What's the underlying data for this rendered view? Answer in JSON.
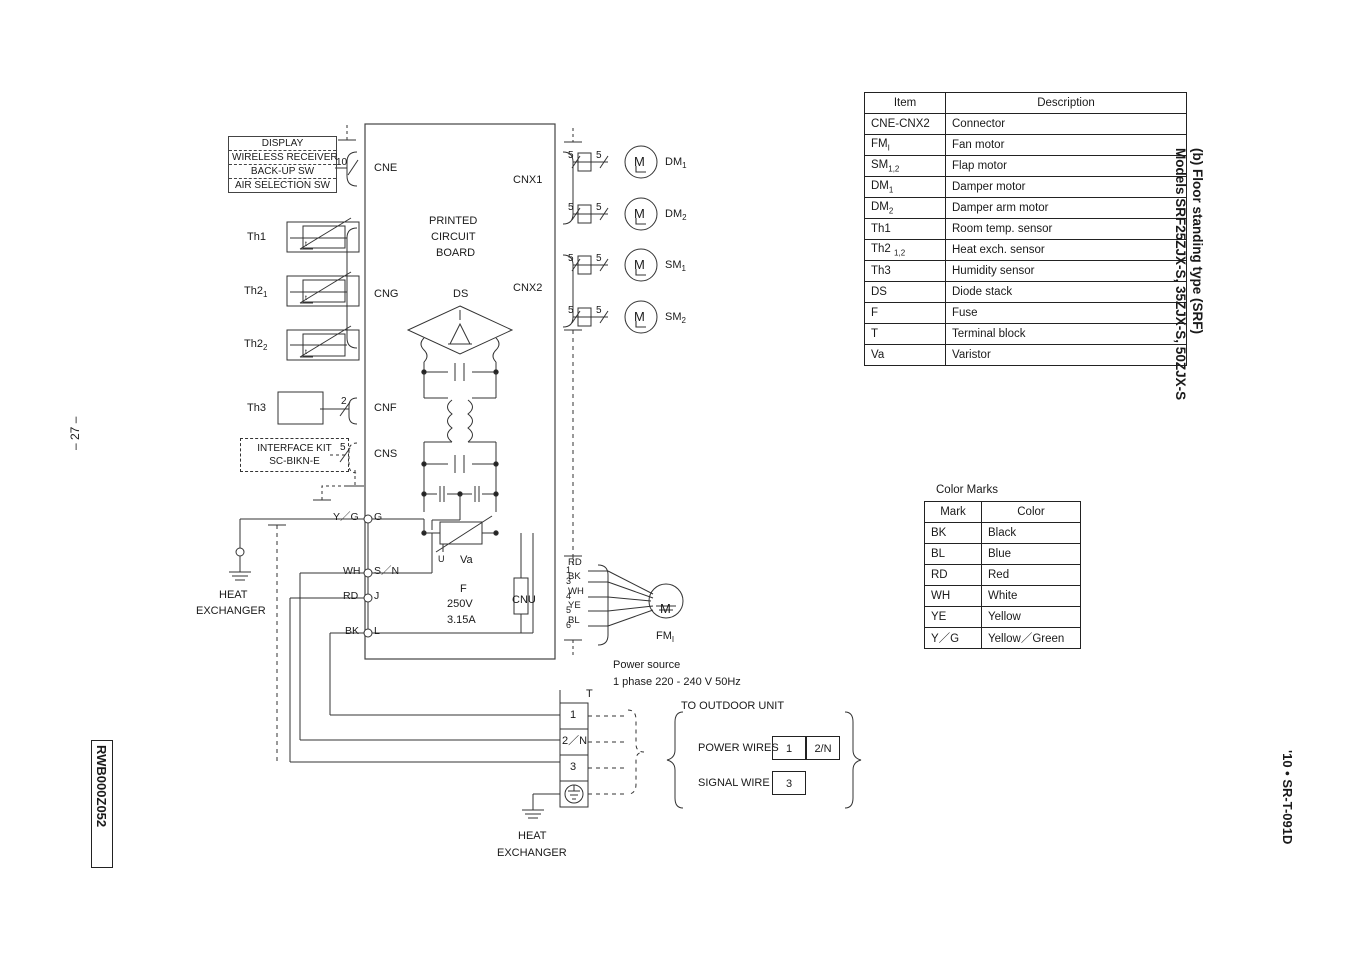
{
  "page": {
    "number": "– 27 –",
    "doc_code": "RWB000Z052",
    "footer_right": "'10 • SR-T-091D",
    "section_label": "(b)  Floor standing type (SRF)",
    "models": "Models SRF25ZJX-S, 35ZJX-S, 50ZJX-S"
  },
  "pcb": {
    "title_line1": "PRINTED",
    "title_line2": "CIRCUIT",
    "title_line3": "BOARD",
    "connectors": [
      "CNE",
      "CNG",
      "CNF",
      "CNS",
      "CNX1",
      "CNX2",
      "CNU"
    ],
    "ds_label": "DS",
    "varistor_label": "Va",
    "varistor_pin": "U",
    "fuse_label": "F",
    "fuse_voltage": "250V",
    "fuse_current": "3.15A"
  },
  "display_panel": {
    "rows": [
      "DISPLAY",
      "WIRELESS RECEIVER",
      "BACK-UP SW",
      "AIR SELECTION SW"
    ],
    "wire_count": "10"
  },
  "interface_kit": {
    "line1": "INTERFACE KIT",
    "line2": "SC-BIKN-E",
    "wire_count": "5"
  },
  "sensors": [
    {
      "label": "Th1",
      "sub": ""
    },
    {
      "label": "Th2",
      "sub": "1"
    },
    {
      "label": "Th2",
      "sub": "2"
    },
    {
      "label": "Th3",
      "sub": "",
      "wire_count": "2"
    }
  ],
  "motors": [
    {
      "label": "DM",
      "sub": "1",
      "wire_in": "5",
      "wire_out": "5",
      "connector": "CNX1"
    },
    {
      "label": "DM",
      "sub": "2",
      "wire_in": "5",
      "wire_out": "5",
      "connector": "CNX1"
    },
    {
      "label": "SM",
      "sub": "1",
      "wire_in": "5",
      "wire_out": "5",
      "connector": "CNX2"
    },
    {
      "label": "SM",
      "sub": "2",
      "wire_in": "5",
      "wire_out": "5",
      "connector": "CNX2"
    }
  ],
  "fan_motor": {
    "label": "FM",
    "sub": "I",
    "pins": [
      "1",
      "3",
      "4",
      "5",
      "6"
    ],
    "wire_colors": [
      "RD",
      "BK",
      "WH",
      "YE",
      "BL"
    ]
  },
  "power_terminals": [
    {
      "mark": "Y／G",
      "pin": "G"
    },
    {
      "mark": "WH",
      "pin": "S／N"
    },
    {
      "mark": "RD",
      "pin": "J"
    },
    {
      "mark": "BK",
      "pin": "L"
    }
  ],
  "heat_exchanger": {
    "left_line1": "HEAT",
    "left_line2": "EXCHANGER",
    "bottom_line1": "HEAT",
    "bottom_line2": "EXCHANGER"
  },
  "power_source": {
    "line1": "Power source",
    "line2": "1 phase 220 - 240 V  50Hz"
  },
  "terminal_block": {
    "label": "T",
    "terminals": [
      "1",
      "2／N",
      "3"
    ],
    "earth": "earth-symbol"
  },
  "outdoor": {
    "title": "TO OUTDOOR UNIT",
    "power_wires_label": "POWER WIRES",
    "power_wires": [
      "1",
      "2/N"
    ],
    "signal_wire_label": "SIGNAL WIRE",
    "signal_wires": [
      "3"
    ]
  },
  "legend": {
    "headers": [
      "Item",
      "Description"
    ],
    "rows": [
      {
        "item": "CNE-CNX2",
        "desc": "Connector"
      },
      {
        "item": "FM",
        "sub": "I",
        "desc": "Fan motor"
      },
      {
        "item": "SM",
        "sub": "1,2",
        "desc": "Flap motor"
      },
      {
        "item": "DM",
        "sub": "1",
        "desc": "Damper motor"
      },
      {
        "item": "DM",
        "sub": "2",
        "desc": "Damper arm motor"
      },
      {
        "item": "Th1",
        "desc": "Room temp. sensor"
      },
      {
        "item": "Th2",
        "sub": "1,2",
        "desc": "Heat exch. sensor"
      },
      {
        "item": "Th3",
        "desc": "Humidity sensor"
      },
      {
        "item": "DS",
        "desc": "Diode stack"
      },
      {
        "item": "F",
        "desc": "Fuse"
      },
      {
        "item": "T",
        "desc": "Terminal block"
      },
      {
        "item": "Va",
        "desc": "Varistor"
      }
    ]
  },
  "color_marks": {
    "title": "Color Marks",
    "headers": [
      "Mark",
      "Color"
    ],
    "rows": [
      {
        "mark": "BK",
        "color": "Black"
      },
      {
        "mark": "BL",
        "color": "Blue"
      },
      {
        "mark": "RD",
        "color": "Red"
      },
      {
        "mark": "WH",
        "color": "White"
      },
      {
        "mark": "YE",
        "color": "Yellow"
      },
      {
        "mark": "Y／G",
        "color": "Yellow／Green"
      }
    ]
  }
}
